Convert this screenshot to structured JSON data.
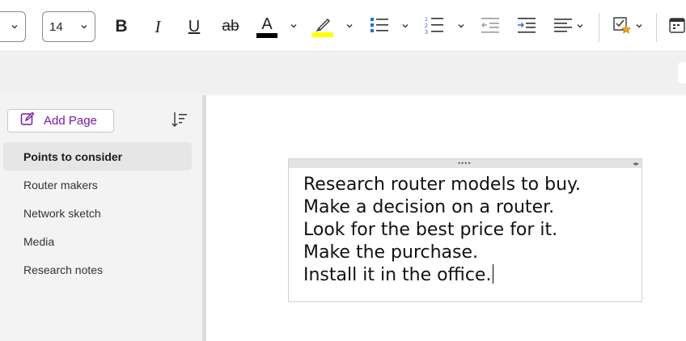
{
  "toolbar": {
    "font_name_value": "",
    "font_size_value": "14",
    "bold_label": "B",
    "italic_label": "I",
    "underline_label": "U",
    "strikethrough_label": "ab",
    "font_color_label": "A",
    "font_color": "#000000",
    "highlight_color": "#ffff00",
    "accent_blue": "#2b6cc4",
    "tag_star_color": "#f0a020"
  },
  "sidebar": {
    "add_page_label": "Add Page",
    "pages": [
      {
        "label": "Points to consider",
        "selected": true
      },
      {
        "label": "Router makers",
        "selected": false
      },
      {
        "label": "Network sketch",
        "selected": false
      },
      {
        "label": "Media",
        "selected": false
      },
      {
        "label": "Research notes",
        "selected": false
      }
    ]
  },
  "note": {
    "lines": [
      "Research router models to buy.",
      "Make a decision on a router.",
      "Look for the best price for it.",
      "Make the purchase.",
      "Install it in the office."
    ],
    "handle_dots": "••••",
    "resize_glyph": "◂▸"
  }
}
